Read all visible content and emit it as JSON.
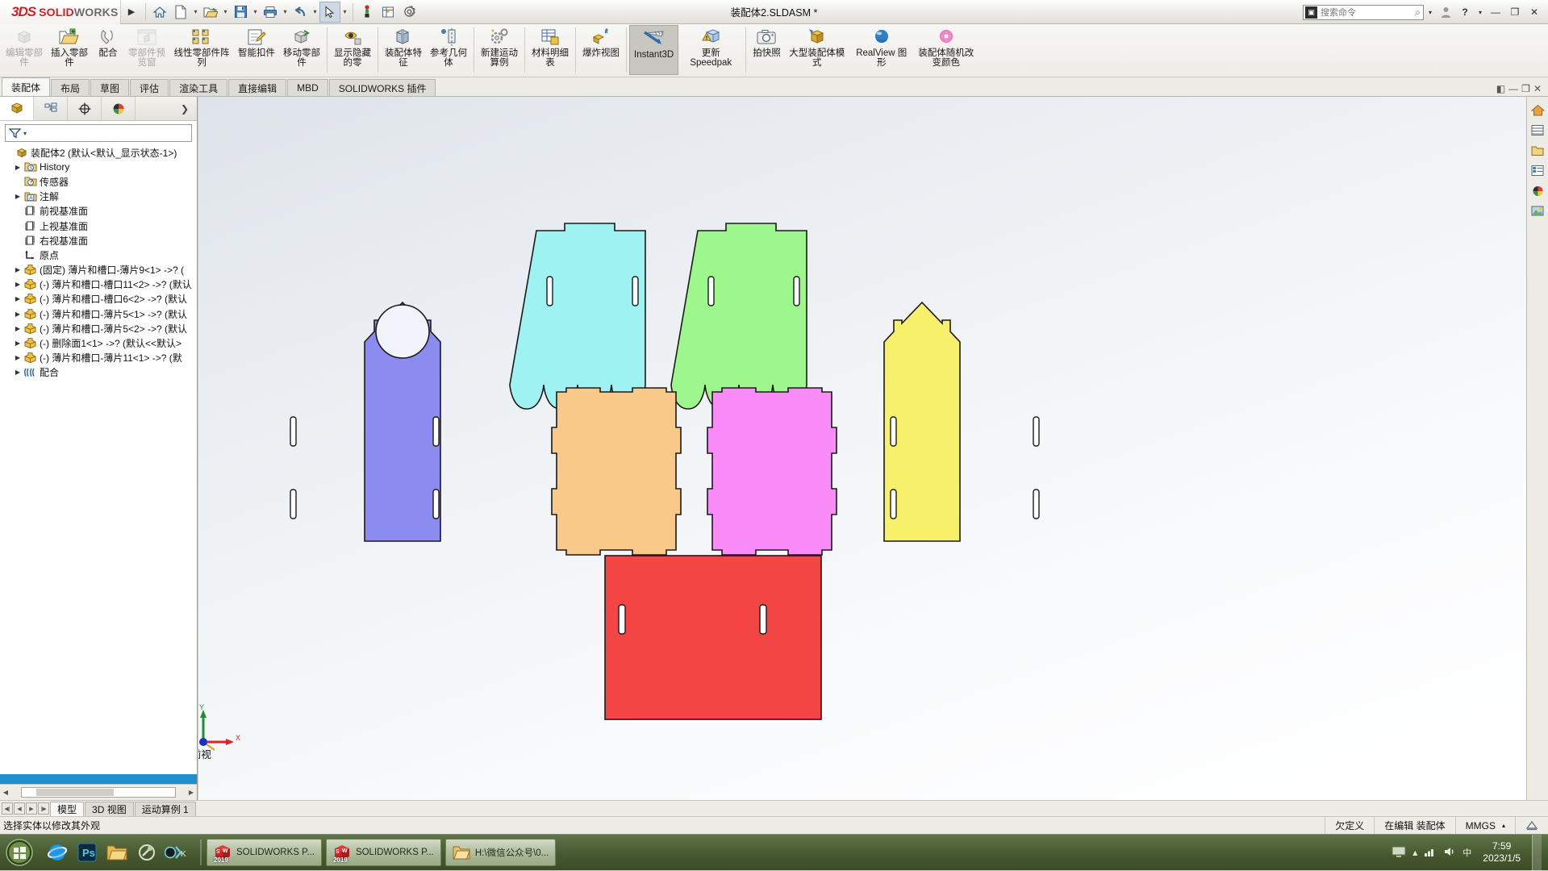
{
  "app": {
    "brand_3ds": "3DS",
    "brand_solid": "SOLID",
    "brand_works": "WORKS",
    "document_title": "装配体2.SLDASM *",
    "search_placeholder": "搜索命令"
  },
  "quick_access": [
    {
      "name": "home-icon",
      "glyph": "⌂"
    },
    {
      "name": "new-document-icon",
      "glyph": "▯"
    },
    {
      "name": "open-folder-icon",
      "glyph": "📂"
    },
    {
      "name": "save-icon",
      "glyph": "💾"
    },
    {
      "name": "print-icon",
      "glyph": "🖨"
    },
    {
      "name": "undo-icon",
      "glyph": "↶"
    },
    {
      "name": "select-cursor-icon",
      "glyph": "➤"
    },
    {
      "name": "rebuild-icon",
      "glyph": "❙"
    },
    {
      "name": "options-gear-icon",
      "glyph": "⚙"
    }
  ],
  "window_controls": {
    "account": "account-icon",
    "help": "?",
    "minimize": "—",
    "restore": "❐",
    "close": "✕"
  },
  "ribbon": {
    "groups": [
      {
        "buttons": [
          {
            "label": "编辑零部件",
            "disabled": true,
            "icon": "edit-component-icon"
          },
          {
            "label": "插入零部件",
            "disabled": false,
            "icon": "insert-component-icon"
          },
          {
            "label": "配合",
            "disabled": false,
            "icon": "mate-icon"
          },
          {
            "label": "零部件预览窗",
            "disabled": true,
            "icon": "component-preview-icon"
          },
          {
            "label": "线性零部件阵列",
            "disabled": false,
            "icon": "linear-component-pattern-icon"
          },
          {
            "label": "智能扣件",
            "disabled": false,
            "icon": "smart-fasteners-icon"
          },
          {
            "label": "移动零部件",
            "disabled": false,
            "icon": "move-component-icon"
          }
        ]
      },
      {
        "buttons": [
          {
            "label": "显示隐藏的零",
            "disabled": false,
            "icon": "show-hidden-components-icon"
          }
        ]
      },
      {
        "buttons": [
          {
            "label": "装配体特征",
            "disabled": false,
            "icon": "assembly-feature-icon"
          },
          {
            "label": "参考几何体",
            "disabled": false,
            "icon": "reference-geometry-icon"
          }
        ]
      },
      {
        "buttons": [
          {
            "label": "新建运动算例",
            "disabled": false,
            "icon": "new-motion-study-icon"
          }
        ]
      },
      {
        "buttons": [
          {
            "label": "材料明细表",
            "disabled": false,
            "icon": "bill-of-materials-icon"
          }
        ]
      },
      {
        "buttons": [
          {
            "label": "爆炸视图",
            "disabled": false,
            "icon": "exploded-view-icon"
          }
        ]
      },
      {
        "buttons": [
          {
            "label": "Instant3D",
            "disabled": false,
            "active": true,
            "icon": "instant3d-icon"
          },
          {
            "label": "更新 Speedpak",
            "disabled": false,
            "icon": "update-speedpak-icon"
          }
        ]
      },
      {
        "buttons": [
          {
            "label": "拍快照",
            "disabled": false,
            "icon": "take-snapshot-icon"
          },
          {
            "label": "大型装配体模式",
            "disabled": false,
            "icon": "large-assembly-mode-icon"
          },
          {
            "label": "RealView 图形",
            "disabled": false,
            "icon": "realview-graphics-icon"
          },
          {
            "label": "装配体随机改变颜色",
            "disabled": false,
            "icon": "random-color-icon"
          }
        ]
      }
    ]
  },
  "command_tabs": [
    {
      "label": "装配体",
      "active": true
    },
    {
      "label": "布局",
      "active": false
    },
    {
      "label": "草图",
      "active": false
    },
    {
      "label": "评估",
      "active": false
    },
    {
      "label": "渲染工具",
      "active": false
    },
    {
      "label": "直接编辑",
      "active": false
    },
    {
      "label": "MBD",
      "active": false
    },
    {
      "label": "SOLIDWORKS 插件",
      "active": false
    }
  ],
  "panel": {
    "tabs": [
      {
        "name": "feature-manager-tab",
        "active": true
      },
      {
        "name": "property-manager-tab",
        "active": false
      },
      {
        "name": "configuration-manager-tab",
        "active": false
      },
      {
        "name": "display-manager-tab",
        "active": false
      }
    ],
    "filter_placeholder": "",
    "tree": [
      {
        "label": "装配体2  (默认<默认_显示状态-1>)",
        "indent": 0,
        "expand": false,
        "icon": "assembly-icon"
      },
      {
        "label": "History",
        "indent": 1,
        "expand": true,
        "icon": "history-icon"
      },
      {
        "label": "传感器",
        "indent": 1,
        "expand": false,
        "icon": "sensors-icon"
      },
      {
        "label": "注解",
        "indent": 1,
        "expand": true,
        "icon": "annotations-icon"
      },
      {
        "label": "前视基准面",
        "indent": 1,
        "expand": false,
        "icon": "plane-icon"
      },
      {
        "label": "上视基准面",
        "indent": 1,
        "expand": false,
        "icon": "plane-icon"
      },
      {
        "label": "右视基准面",
        "indent": 1,
        "expand": false,
        "icon": "plane-icon"
      },
      {
        "label": "原点",
        "indent": 1,
        "expand": false,
        "icon": "origin-icon"
      },
      {
        "label": "(固定) 薄片和槽口-薄片9<1> ->? (",
        "indent": 1,
        "expand": true,
        "icon": "component-icon"
      },
      {
        "label": "(-) 薄片和槽口-槽口11<2> ->? (默认",
        "indent": 1,
        "expand": true,
        "icon": "component-icon"
      },
      {
        "label": "(-) 薄片和槽口-槽口6<2> ->? (默认",
        "indent": 1,
        "expand": true,
        "icon": "component-icon"
      },
      {
        "label": "(-) 薄片和槽口-薄片5<1> ->? (默认",
        "indent": 1,
        "expand": true,
        "icon": "component-icon"
      },
      {
        "label": "(-) 薄片和槽口-薄片5<2> ->? (默认",
        "indent": 1,
        "expand": true,
        "icon": "component-icon"
      },
      {
        "label": "(-) 删除面1<1> ->? (默认<<默认>",
        "indent": 1,
        "expand": true,
        "icon": "component-icon"
      },
      {
        "label": "(-) 薄片和槽口-薄片11<1> ->? (默",
        "indent": 1,
        "expand": true,
        "icon": "component-icon"
      },
      {
        "label": "配合",
        "indent": 1,
        "expand": true,
        "icon": "mates-folder-icon"
      }
    ]
  },
  "view_toolbar": [
    {
      "name": "zoom-to-fit-icon"
    },
    {
      "name": "zoom-to-area-icon"
    },
    {
      "name": "previous-view-icon"
    },
    {
      "name": "section-view-icon"
    },
    {
      "name": "view-orientation-icon"
    },
    {
      "name": "display-style-icon"
    },
    {
      "name": "hide-show-items-icon"
    },
    {
      "name": "edit-appearance-icon"
    },
    {
      "name": "apply-scene-icon"
    },
    {
      "name": "view-settings-icon"
    }
  ],
  "graphics": {
    "view_label": "*前视",
    "triad": {
      "x": "X",
      "y": "Y"
    },
    "parts": [
      {
        "name": "cyan-scalloped-panel",
        "fill": "#9ff2f2",
        "stroke": "#1a1a1a"
      },
      {
        "name": "green-scalloped-panel",
        "fill": "#9ef78c",
        "stroke": "#1a1a1a"
      },
      {
        "name": "blue-house-panel",
        "fill": "#8b8bf0",
        "stroke": "#1a1a1a"
      },
      {
        "name": "orange-base-panel",
        "fill": "#f9c98a",
        "stroke": "#1a1a1a"
      },
      {
        "name": "magenta-base-panel",
        "fill": "#fa8cfa",
        "stroke": "#1a1a1a"
      },
      {
        "name": "yellow-house-panel",
        "fill": "#f6f06a",
        "stroke": "#1a1a1a"
      },
      {
        "name": "red-floor-panel",
        "fill": "#f44545",
        "stroke": "#1a1a1a"
      }
    ]
  },
  "bottom_tabs": [
    {
      "label": "模型",
      "active": true
    },
    {
      "label": "3D 视图",
      "active": false
    },
    {
      "label": "运动算例 1",
      "active": false
    }
  ],
  "status_bar": {
    "message": "选择实体以修改其外观",
    "state": "欠定义",
    "editing": "在编辑 装配体",
    "units": "MMGS"
  },
  "taskbar": {
    "items": [
      {
        "label": "SOLIDWORKS P...",
        "icon": "solidworks-2019-icon",
        "badge": "2019"
      },
      {
        "label": "SOLIDWORKS P...",
        "icon": "solidworks-2019-icon",
        "badge": "2019"
      },
      {
        "label": "H:\\微信公众号\\0...",
        "icon": "folder-icon",
        "badge": ""
      }
    ],
    "quick_launch": [
      {
        "name": "ie-icon"
      },
      {
        "name": "photoshop-icon"
      },
      {
        "name": "explorer-icon"
      },
      {
        "name": "tool-icon"
      },
      {
        "name": "camtasia-icon"
      }
    ],
    "clock_time": "7:59",
    "clock_date": "2023/1/5"
  }
}
